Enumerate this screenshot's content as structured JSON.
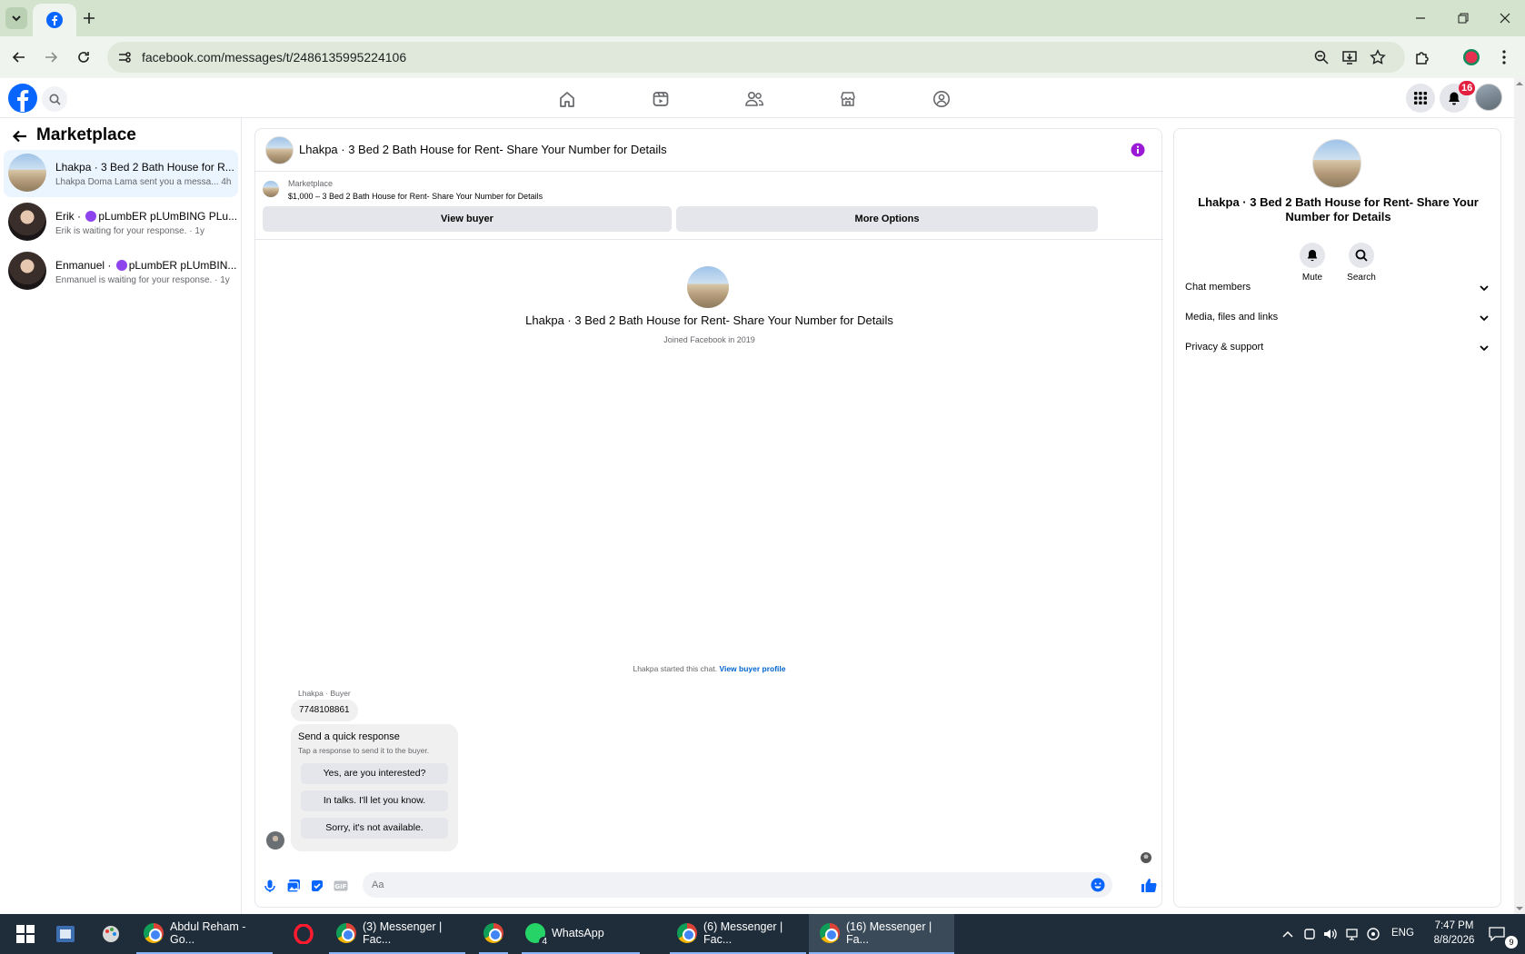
{
  "browser": {
    "url": "facebook.com/messages/t/2486135995224106",
    "tab_icon": "facebook-icon"
  },
  "header": {
    "notifications_badge": "16",
    "nav_icons": [
      "home-icon",
      "video-icon",
      "friends-icon",
      "marketplace-icon",
      "groups-icon"
    ]
  },
  "sidebar": {
    "title": "Marketplace",
    "conversations": [
      {
        "name": "Lhakpa · 3 Bed 2 Bath House for R...",
        "preview": "Lhakpa Doma Lama sent you a messa...",
        "time": "4h"
      },
      {
        "name_prefix": "Erik · ",
        "name_suffix": "pLumbER pLUmBING PLu...",
        "preview": "Erik is waiting for your response. · 1y"
      },
      {
        "name_prefix": "Enmanuel · ",
        "name_suffix": "pLumbER pLUmBIN...",
        "preview": "Enmanuel is waiting for your response. · 1y"
      }
    ]
  },
  "chat": {
    "title": "Lhakpa · 3 Bed 2 Bath House for Rent- Share Your Number for Details",
    "listing_source": "Marketplace",
    "listing_desc": "$1,000 – 3 Bed 2 Bath House for Rent- Share Your Number for Details",
    "view_buyer": "View buyer",
    "more_options": "More Options",
    "intro_name": "Lhakpa · 3 Bed 2 Bath House for Rent- Share Your Number for Details",
    "intro_joined": "Joined Facebook in 2019",
    "started_text": "Lhakpa started this chat. ",
    "started_link": "View buyer profile",
    "sender_label": "Lhakpa · Buyer",
    "message": "7748108861",
    "quick_title": "Send a quick response",
    "quick_sub": "Tap a response to send it to the buyer.",
    "quick_replies": [
      "Yes, are you interested?",
      "In talks. I'll let you know.",
      "Sorry, it's not available."
    ],
    "composer_placeholder": "Aa"
  },
  "right_panel": {
    "name": "Lhakpa · 3 Bed 2 Bath House for Rent- Share Your Number for Details",
    "mute": "Mute",
    "search": "Search",
    "sections": [
      "Chat members",
      "Media, files and links",
      "Privacy & support"
    ]
  },
  "taskbar": {
    "apps": [
      {
        "label": "Abdul Reham - Go..."
      },
      {
        "label": "(3) Messenger | Fac..."
      },
      {
        "label": "WhatsApp",
        "badge": "4"
      },
      {
        "label": "(6) Messenger | Fac..."
      },
      {
        "label": "(16) Messenger | Fa..."
      }
    ],
    "lang": "ENG",
    "time": "7:47 PM",
    "date": "8/8/2026",
    "notif_count": "9"
  },
  "colors": {
    "fb_blue": "#0866ff",
    "active_conv": "#ebf5ff",
    "link": "#0064d1",
    "purple_dot": "#8e44ec",
    "taskbar": "#1f2d3a"
  }
}
